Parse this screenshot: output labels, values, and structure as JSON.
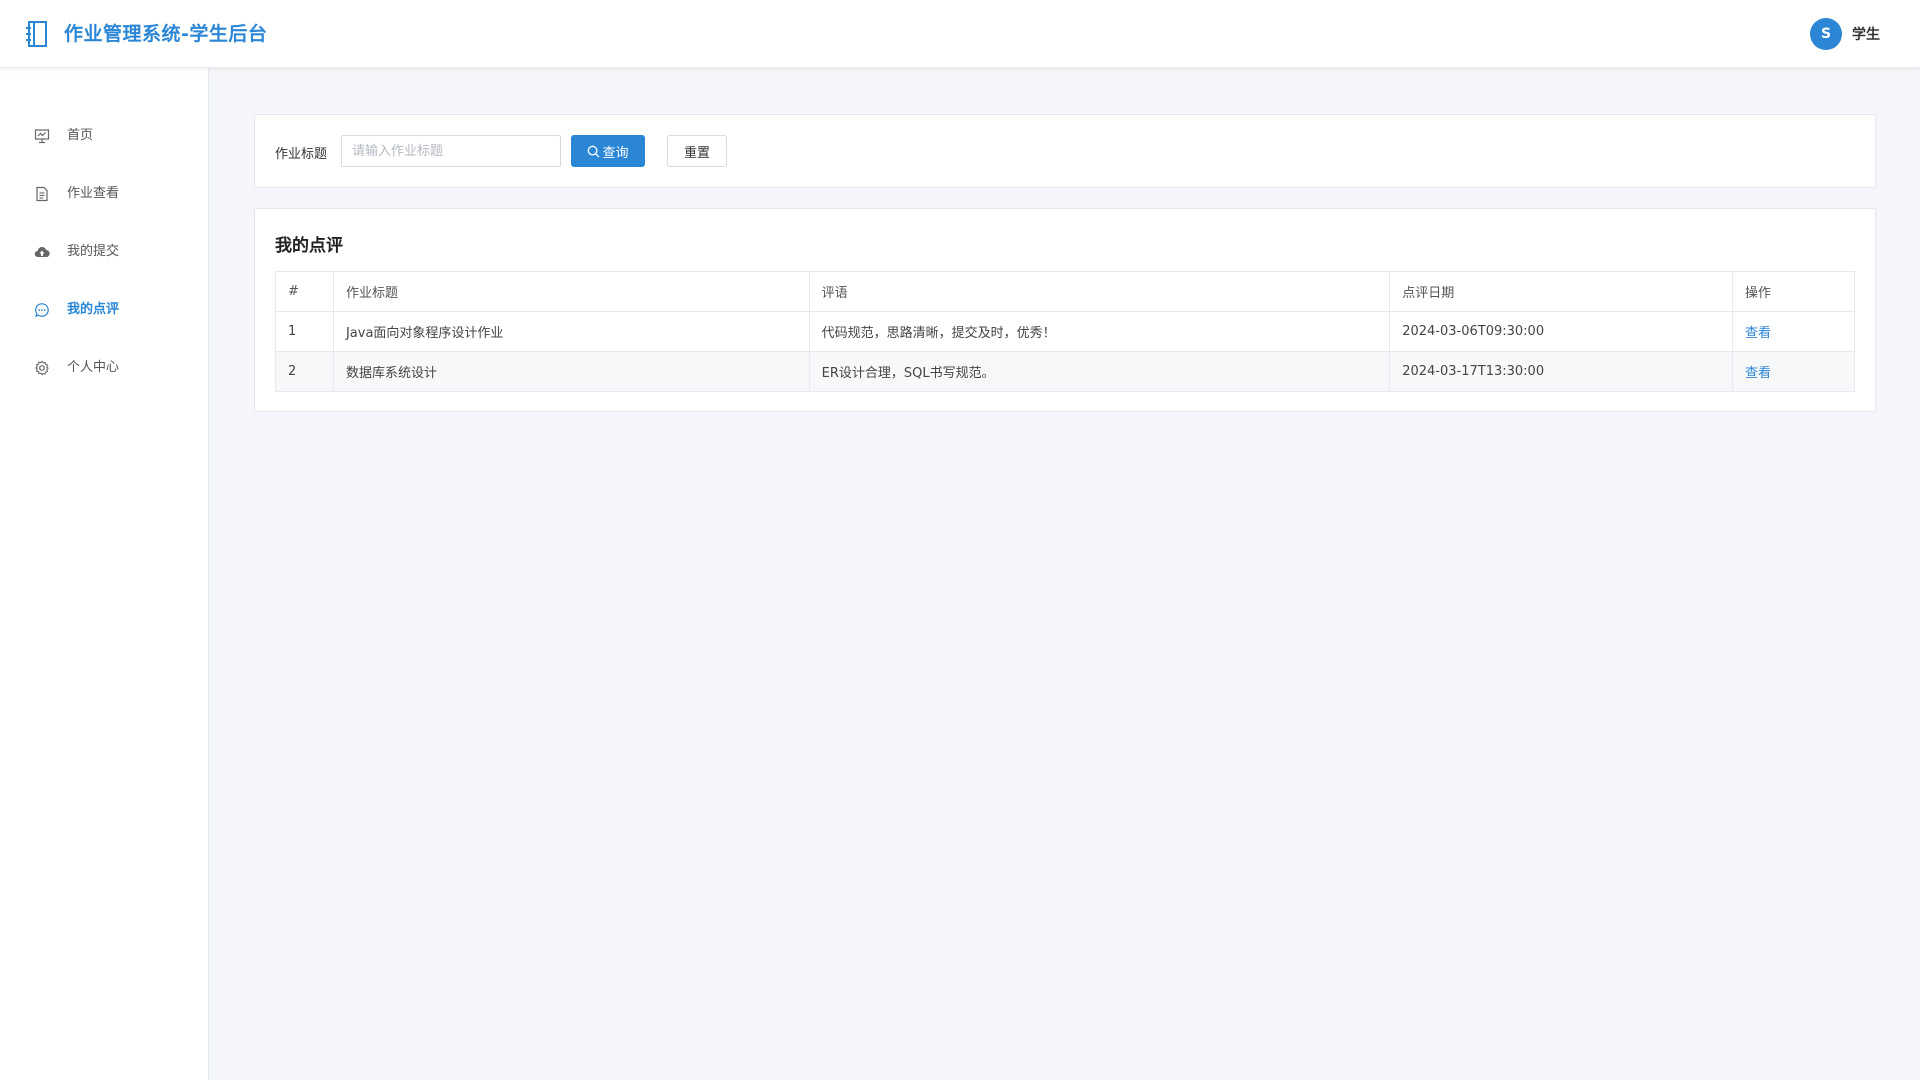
{
  "header": {
    "title": "作业管理系统-学生后台",
    "user_avatar": "S",
    "user_name": "学生",
    "accent": "#2b86d6"
  },
  "sidebar": {
    "items": [
      {
        "label": "首页",
        "icon": "presentation-icon",
        "active": false
      },
      {
        "label": "作业查看",
        "icon": "document-icon",
        "active": false
      },
      {
        "label": "我的提交",
        "icon": "cloud-upload-icon",
        "active": false
      },
      {
        "label": "我的点评",
        "icon": "chat-icon",
        "active": true
      },
      {
        "label": "个人中心",
        "icon": "gear-icon",
        "active": false
      }
    ]
  },
  "search": {
    "label": "作业标题",
    "placeholder": "请输入作业标题",
    "value": "",
    "query_label": "查询",
    "reset_label": "重置"
  },
  "reviews": {
    "title": "我的点评",
    "columns": [
      "#",
      "作业标题",
      "评语",
      "点评日期",
      "操作"
    ],
    "rows": [
      {
        "index": "1",
        "title": "Java面向对象程序设计作业",
        "comment": "代码规范，思路清晰，提交及时，优秀！",
        "date": "2024-03-06T09:30:00",
        "action": "查看"
      },
      {
        "index": "2",
        "title": "数据库系统设计",
        "comment": "ER设计合理，SQL书写规范。",
        "date": "2024-03-17T13:30:00",
        "action": "查看"
      }
    ]
  }
}
